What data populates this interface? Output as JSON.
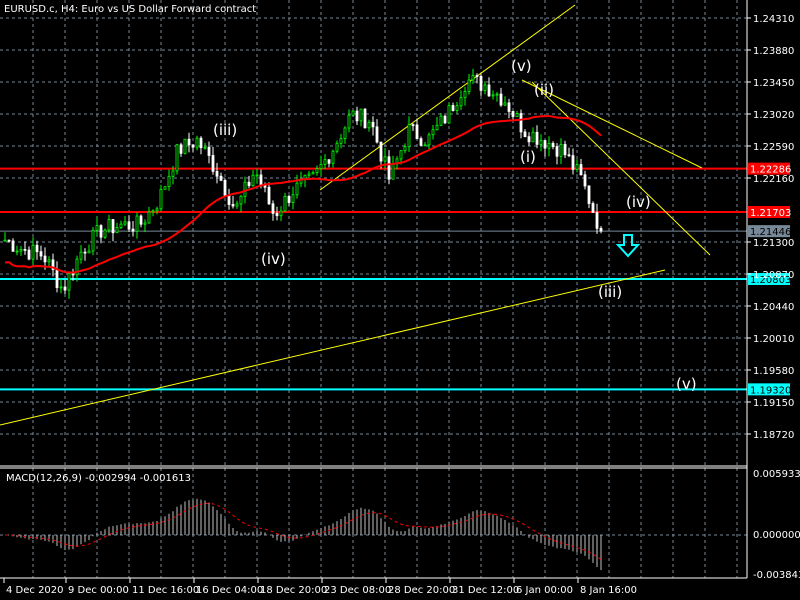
{
  "header": {
    "title": "EURUSD.c, H4:  Euro vs US Dollar Forward contract"
  },
  "price_axis": {
    "labels": [
      "1.24310",
      "1.23880",
      "1.23450",
      "1.23020",
      "1.22590",
      "1.22160",
      "1.21300",
      "1.20870",
      "1.20440",
      "1.20010",
      "1.19580",
      "1.19150",
      "1.18720"
    ],
    "max": 1.2431,
    "step": 0.0043
  },
  "levels": [
    {
      "price": 1.22286,
      "label": "1.22286",
      "color": "#ff0000",
      "text_color": "#ffffff"
    },
    {
      "price": 1.21703,
      "label": "1.21703",
      "color": "#ff0000",
      "text_color": "#ffffff"
    },
    {
      "price": 1.21446,
      "label": "1.21446",
      "color": "#778899",
      "text_color": "#000000"
    },
    {
      "price": 1.20803,
      "label": "1.20803",
      "color": "#00ffff",
      "text_color": "#000000"
    },
    {
      "price": 1.1932,
      "label": "1.19320",
      "color": "#00ffff",
      "text_color": "#000000"
    }
  ],
  "time_axis": {
    "labels": [
      "4 Dec 2020",
      "9 Dec 00:00",
      "11 Dec 16:00",
      "16 Dec 04:00",
      "18 Dec 20:00",
      "23 Dec 08:00",
      "28 Dec 20:00",
      "31 Dec 12:00",
      "6 Jan 00:00",
      "8 Jan 16:00"
    ]
  },
  "price_path": [
    1.21327,
    1.21192,
    1.21125,
    1.20655,
    1.21192,
    1.21461,
    1.21528,
    1.21528,
    1.21864,
    1.22536,
    1.22671,
    1.22267,
    1.2173,
    1.22267,
    1.21663,
    1.21999,
    1.22133,
    1.22536,
    1.23007,
    1.22939,
    1.22133,
    1.22805,
    1.22671,
    1.23007,
    1.23477,
    1.2341,
    1.23208,
    1.22805,
    1.22671,
    1.22536,
    1.22133,
    1.21446
  ],
  "wave_labels": [
    "(iii)",
    "(iv)",
    "(v)",
    "(ii)",
    "(i)",
    "(iv)",
    "(iii)",
    "(v)"
  ],
  "macd": {
    "label": "MACD(12,26,9) -0.002994 -0.001613",
    "axis": [
      "0.005933",
      "0.000000",
      "-0.003843"
    ]
  },
  "colors": {
    "grid": "#778899",
    "bull": "#00ff00",
    "bear": "#ffffff",
    "ma": "#ff0000",
    "trend": "#ffff00",
    "signal": "#ff0000",
    "hist": "#c0c0c0",
    "arrow": "#00ffff"
  }
}
